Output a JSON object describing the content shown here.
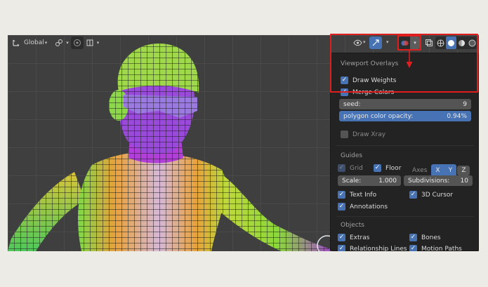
{
  "header": {
    "orientation_label": "Global",
    "icons": [
      "transform-axes-icon",
      "link-icon",
      "proportional-icon",
      "snap-icon"
    ]
  },
  "overlay_popup": {
    "title": "Viewport Overlays",
    "draw_weights": {
      "label": "Draw Weights",
      "checked": true
    },
    "merge_colors": {
      "label": "Merge Colors",
      "checked": true
    },
    "seed": {
      "label": "seed:",
      "value": "9"
    },
    "polygon_opacity": {
      "label": "polygon color opacity:",
      "value": "0.94%",
      "fill_percent": 94
    },
    "draw_xray": {
      "label": "Draw Xray",
      "checked": false
    }
  },
  "guides": {
    "title": "Guides",
    "grid": {
      "label": "Grid",
      "checked": true
    },
    "floor": {
      "label": "Floor",
      "checked": true
    },
    "axes_label": "Axes",
    "axes": [
      "X",
      "Y",
      "Z"
    ],
    "scale": {
      "label": "Scale:",
      "value": "1.000"
    },
    "subdivisions": {
      "label": "Subdivisions:",
      "value": "10"
    },
    "text_info": {
      "label": "Text Info",
      "checked": true
    },
    "cursor_3d": {
      "label": "3D Cursor",
      "checked": true
    },
    "annotations": {
      "label": "Annotations",
      "checked": true
    }
  },
  "objects": {
    "title": "Objects",
    "extras": {
      "label": "Extras",
      "checked": true
    },
    "bones": {
      "label": "Bones",
      "checked": true
    },
    "relationship_lines": {
      "label": "Relationship Lines",
      "checked": true
    },
    "motion_paths": {
      "label": "Motion Paths",
      "checked": true
    }
  },
  "colors": {
    "accent": "#4772b3",
    "highlight": "#e01e1e",
    "panel_bg": "#232323"
  }
}
